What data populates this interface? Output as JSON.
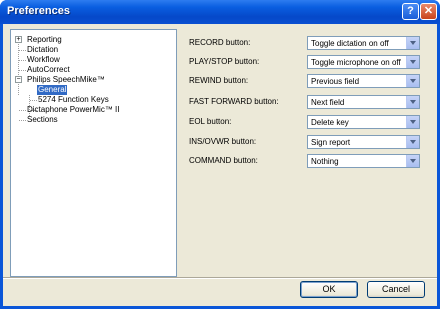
{
  "window": {
    "title": "Preferences",
    "help_label": "?",
    "close_label": "✕"
  },
  "tree": {
    "items": [
      {
        "label": "Reporting",
        "expander": "+"
      },
      {
        "label": "Dictation"
      },
      {
        "label": "Workflow"
      },
      {
        "label": "AutoCorrect"
      },
      {
        "label": "Philips SpeechMike™",
        "expander": "−"
      },
      {
        "label": "General",
        "selected": true
      },
      {
        "label": "5274 Function Keys"
      },
      {
        "label": "Dictaphone PowerMic™ II"
      },
      {
        "label": "Sections"
      }
    ]
  },
  "settings": {
    "rows": [
      {
        "label": "RECORD button:",
        "value": "Toggle dictation on off"
      },
      {
        "label": "PLAY/STOP button:",
        "value": "Toggle microphone on off"
      },
      {
        "label": "REWIND button:",
        "value": "Previous field"
      },
      {
        "label": "FAST FORWARD button:",
        "value": "Next field"
      },
      {
        "label": "EOL button:",
        "value": "Delete key"
      },
      {
        "label": "INS/OVWR button:",
        "value": "Sign report"
      },
      {
        "label": "COMMAND button:",
        "value": "Nothing"
      }
    ]
  },
  "footer": {
    "ok_label": "OK",
    "cancel_label": "Cancel"
  }
}
